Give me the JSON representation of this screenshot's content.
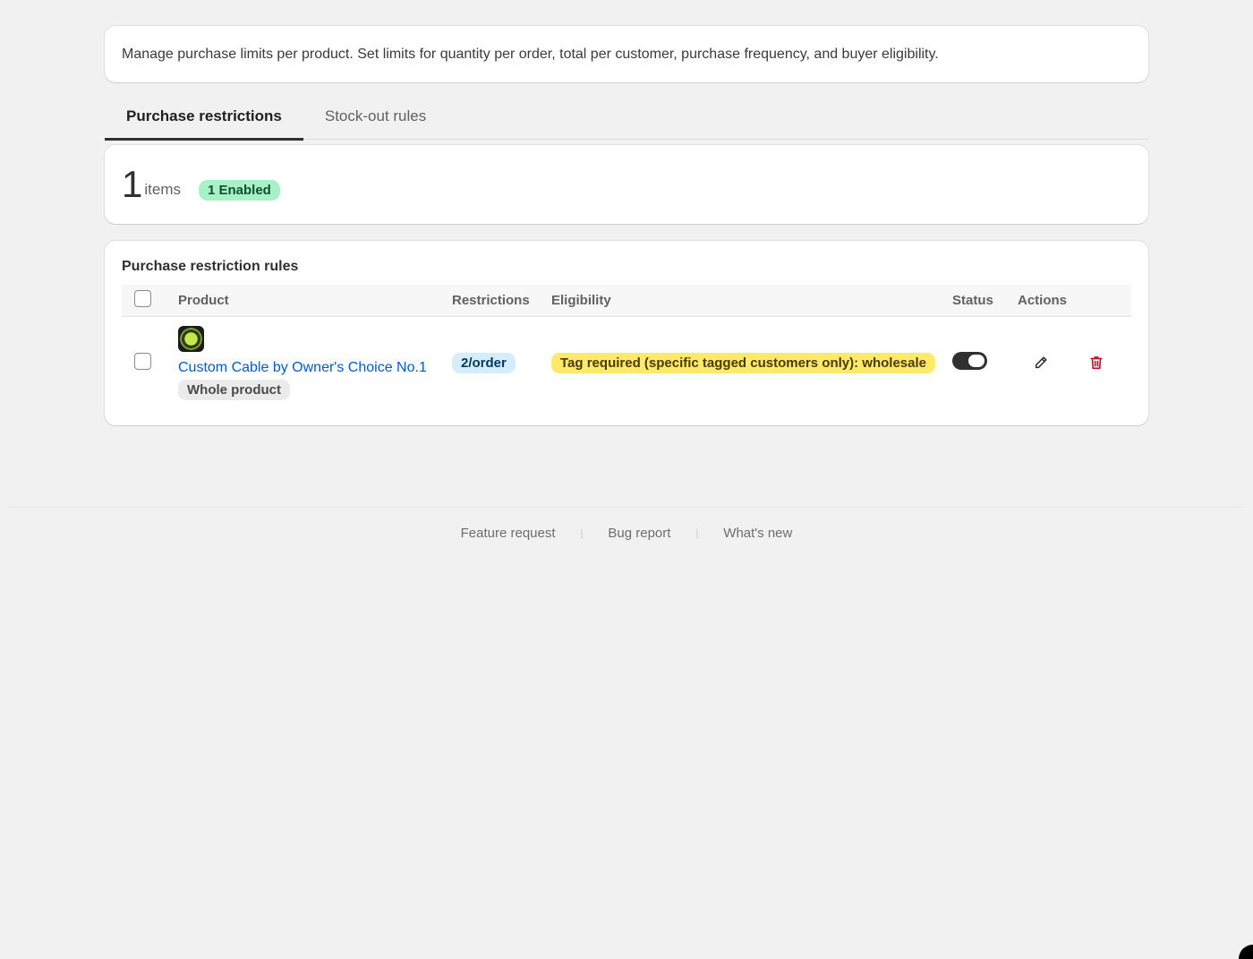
{
  "intro": {
    "text": "Manage purchase limits per product. Set limits for quantity per order, total per customer, purchase frequency, and buyer eligibility."
  },
  "tabs": [
    {
      "label": "Purchase restrictions",
      "active": true
    },
    {
      "label": "Stock-out rules",
      "active": false
    }
  ],
  "summary": {
    "count": "1",
    "items_label": "items",
    "enabled_badge": "1 Enabled"
  },
  "rules": {
    "title": "Purchase restriction rules",
    "columns": {
      "product": "Product",
      "restrictions": "Restrictions",
      "eligibility": "Eligibility",
      "status": "Status",
      "actions": "Actions"
    },
    "rows": [
      {
        "product_name": "Custom Cable by Owner's Choice No.1",
        "scope": "Whole product",
        "restriction": "2/order",
        "eligibility": "Tag required (specific tagged customers only): wholesale",
        "enabled": true
      }
    ]
  },
  "footer": {
    "feature_request": "Feature request",
    "bug_report": "Bug report",
    "whats_new": "What's new"
  },
  "icons": {
    "edit": "pencil-icon",
    "delete": "trash-icon"
  },
  "colors": {
    "link": "#005bd3",
    "delete": "#c70a24",
    "enabled_badge_bg": "#a8f0c6",
    "restriction_bg": "#d6ecff",
    "eligibility_bg": "#ffe96a"
  }
}
